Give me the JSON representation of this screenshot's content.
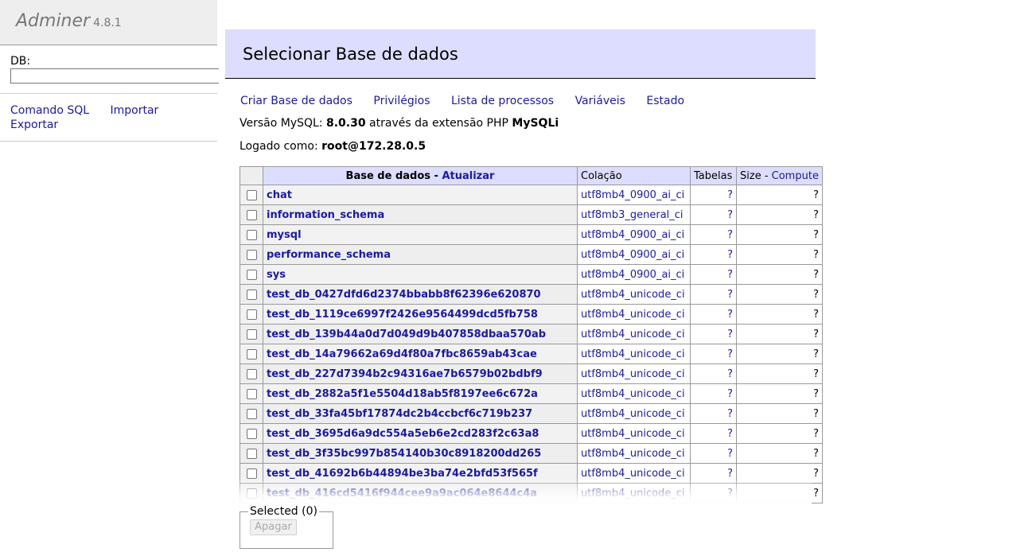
{
  "app": {
    "name": "Adminer",
    "version": "4.8.1"
  },
  "sidebar": {
    "db_label": "DB:",
    "links": [
      "Comando SQL",
      "Importar",
      "Exportar"
    ]
  },
  "page": {
    "title": "Selecionar Base de dados",
    "nav": [
      "Criar Base de dados",
      "Privilégios",
      "Lista de processos",
      "Variáveis",
      "Estado"
    ],
    "version_prefix": "Versão MySQL: ",
    "version_value": "8.0.30",
    "version_middle": " através da extensão PHP ",
    "version_ext": "MySQLi",
    "logged_prefix": "Logado como: ",
    "logged_user": "root@172.28.0.5"
  },
  "table": {
    "headers": {
      "database": "Base de dados",
      "refresh": "Atualizar",
      "collation": "Colação",
      "tables": "Tabelas",
      "size": "Size",
      "compute": "Compute"
    },
    "rows": [
      {
        "name": "chat",
        "collation": "utf8mb4_0900_ai_ci",
        "tables": "?",
        "size": "?"
      },
      {
        "name": "information_schema",
        "collation": "utf8mb3_general_ci",
        "tables": "?",
        "size": "?"
      },
      {
        "name": "mysql",
        "collation": "utf8mb4_0900_ai_ci",
        "tables": "?",
        "size": "?"
      },
      {
        "name": "performance_schema",
        "collation": "utf8mb4_0900_ai_ci",
        "tables": "?",
        "size": "?"
      },
      {
        "name": "sys",
        "collation": "utf8mb4_0900_ai_ci",
        "tables": "?",
        "size": "?"
      },
      {
        "name": "test_db_0427dfd6d2374bbabb8f62396e620870",
        "collation": "utf8mb4_unicode_ci",
        "tables": "?",
        "size": "?"
      },
      {
        "name": "test_db_1119ce6997f2426e9564499dcd5fb758",
        "collation": "utf8mb4_unicode_ci",
        "tables": "?",
        "size": "?"
      },
      {
        "name": "test_db_139b44a0d7d049d9b407858dbaa570ab",
        "collation": "utf8mb4_unicode_ci",
        "tables": "?",
        "size": "?"
      },
      {
        "name": "test_db_14a79662a69d4f80a7fbc8659ab43cae",
        "collation": "utf8mb4_unicode_ci",
        "tables": "?",
        "size": "?"
      },
      {
        "name": "test_db_227d7394b2c94316ae7b6579b02bdbf9",
        "collation": "utf8mb4_unicode_ci",
        "tables": "?",
        "size": "?"
      },
      {
        "name": "test_db_2882a5f1e5504d18ab5f8197ee6c672a",
        "collation": "utf8mb4_unicode_ci",
        "tables": "?",
        "size": "?"
      },
      {
        "name": "test_db_33fa45bf17874dc2b4ccbcf6c719b237",
        "collation": "utf8mb4_unicode_ci",
        "tables": "?",
        "size": "?"
      },
      {
        "name": "test_db_3695d6a9dc554a5eb6e2cd283f2c63a8",
        "collation": "utf8mb4_unicode_ci",
        "tables": "?",
        "size": "?"
      },
      {
        "name": "test_db_3f35bc997b854140b30c8918200dd265",
        "collation": "utf8mb4_unicode_ci",
        "tables": "?",
        "size": "?"
      },
      {
        "name": "test_db_41692b6b44894be3ba74e2bfd53f565f",
        "collation": "utf8mb4_unicode_ci",
        "tables": "?",
        "size": "?"
      },
      {
        "name": "test_db_416cd5416f944cee9a9ac064e8644c4a",
        "collation": "utf8mb4_unicode_ci",
        "tables": "?",
        "size": "?"
      }
    ]
  },
  "selection": {
    "legend": "Selected (0)",
    "delete_label": "Apagar"
  }
}
